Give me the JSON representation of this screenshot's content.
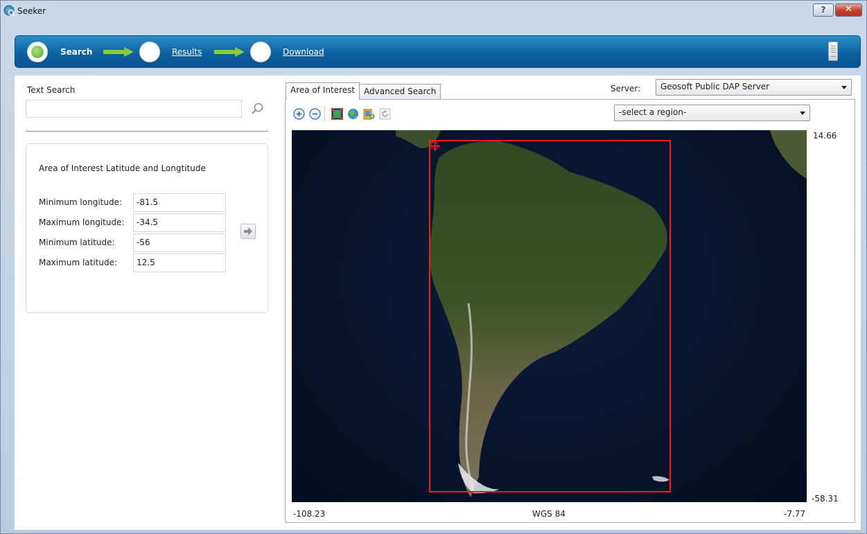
{
  "window": {
    "title": "Seeker",
    "help_label": "?",
    "close_label": "✕"
  },
  "wizard": {
    "steps": [
      {
        "label": "Search",
        "active": true
      },
      {
        "label": "Results",
        "active": false
      },
      {
        "label": "Download",
        "active": false
      }
    ]
  },
  "text_search": {
    "label": "Text Search",
    "value": "",
    "placeholder": ""
  },
  "aoi": {
    "title": "Area of Interest Latitude and Longtitude",
    "fields": [
      {
        "label": "Minimum longitude:",
        "value": "-81.5"
      },
      {
        "label": "Maximum longitude:",
        "value": "-34.5"
      },
      {
        "label": "Minimum latitude:",
        "value": "-56"
      },
      {
        "label": "Maximum latitude:",
        "value": "12.5"
      }
    ]
  },
  "tabs": [
    {
      "label": "Area of Interest",
      "active": true
    },
    {
      "label": "Advanced Search",
      "active": false
    }
  ],
  "server": {
    "label": "Server:",
    "selected": "Geosoft Public DAP Server"
  },
  "region": {
    "selected": "-select a region-"
  },
  "toolbar": {
    "icons": [
      "zoom-in-icon",
      "zoom-out-icon",
      "select-extent-icon",
      "globe-icon",
      "bookmark-icon",
      "refresh-icon"
    ]
  },
  "map": {
    "top_right": "14.66",
    "bottom_right": "-58.31",
    "bottom_left": "-108.23",
    "bottom_center": "WGS 84",
    "bottom_right_x": "-7.77"
  },
  "colors": {
    "header_blue": "#0b5f9f",
    "active_step": "#58b02b",
    "aoi_border": "#ff1a1a",
    "arrow_green": "#8ccc3c"
  }
}
